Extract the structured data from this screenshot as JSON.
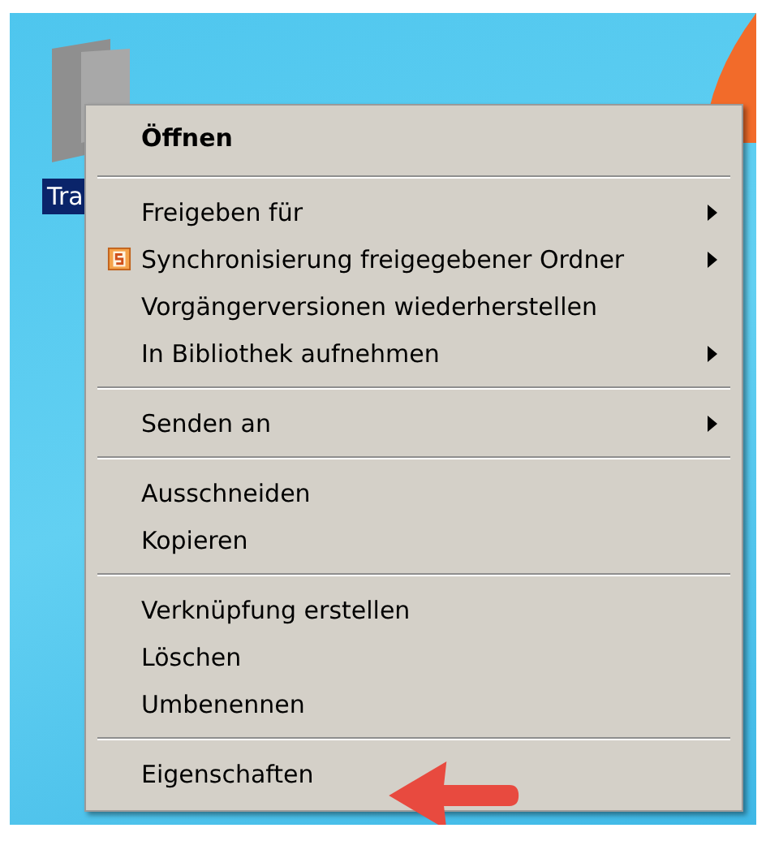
{
  "desktop": {
    "icon_label": "Tra"
  },
  "context_menu": {
    "groups": [
      {
        "items": [
          {
            "label": "Öffnen",
            "default": true,
            "submenu": false,
            "icon": false
          }
        ]
      },
      {
        "items": [
          {
            "label": "Freigeben für",
            "default": false,
            "submenu": true,
            "icon": false
          },
          {
            "label": "Synchronisierung freigegebener Ordner",
            "default": false,
            "submenu": true,
            "icon": true
          },
          {
            "label": "Vorgängerversionen wiederherstellen",
            "default": false,
            "submenu": false,
            "icon": false
          },
          {
            "label": "In Bibliothek aufnehmen",
            "default": false,
            "submenu": true,
            "icon": false
          }
        ]
      },
      {
        "items": [
          {
            "label": "Senden an",
            "default": false,
            "submenu": true,
            "icon": false
          }
        ]
      },
      {
        "items": [
          {
            "label": "Ausschneiden",
            "default": false,
            "submenu": false,
            "icon": false
          },
          {
            "label": "Kopieren",
            "default": false,
            "submenu": false,
            "icon": false
          }
        ]
      },
      {
        "items": [
          {
            "label": "Verknüpfung erstellen",
            "default": false,
            "submenu": false,
            "icon": false
          },
          {
            "label": "Löschen",
            "default": false,
            "submenu": false,
            "icon": false
          },
          {
            "label": "Umbenennen",
            "default": false,
            "submenu": false,
            "icon": false
          }
        ]
      },
      {
        "items": [
          {
            "label": "Eigenschaften",
            "default": false,
            "submenu": false,
            "icon": false
          }
        ]
      }
    ]
  }
}
